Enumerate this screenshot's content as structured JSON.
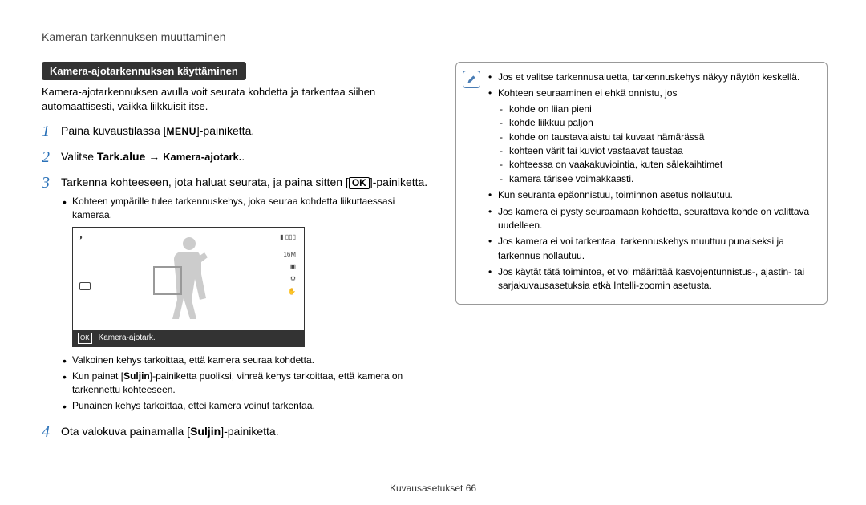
{
  "header": "Kameran tarkennuksen muuttaminen",
  "section_title": "Kamera-ajotarkennuksen käyttäminen",
  "intro": "Kamera-ajotarkennuksen avulla voit seurata kohdetta ja tarkentaa siihen automaattisesti, vaikka liikkuisit itse.",
  "steps": {
    "s1_a": "Paina kuvaustilassa [",
    "s1_menu": "MENU",
    "s1_b": "]-painiketta.",
    "s2_a": "Valitse ",
    "s2_b": "Tark.alue",
    "s2_c": " → ",
    "s2_d": "Kamera-ajotark.",
    "s2_e": ".",
    "s3_a": "Tarkenna kohteeseen, jota haluat seurata, ja paina sitten [",
    "s3_ok": "OK",
    "s3_b": "]-painiketta.",
    "s3_bullets": [
      "Kohteen ympärille tulee tarkennuskehys, joka seuraa kohdetta liikuttaessasi kameraa."
    ],
    "s3_caption_label": "Kamera-ajotark.",
    "s3_explain": {
      "a": "Valkoinen kehys tarkoittaa, että kamera seuraa kohdetta.",
      "b_pre": "Kun painat [",
      "b_bold": "Suljin",
      "b_post": "]-painiketta puoliksi, vihreä kehys tarkoittaa, että kamera on tarkennettu kohteeseen.",
      "c": "Punainen kehys tarkoittaa, ettei kamera voinut tarkentaa."
    },
    "s4_a": "Ota valokuva painamalla [",
    "s4_bold": "Suljin",
    "s4_b": "]-painiketta."
  },
  "info": {
    "l1": "Jos et valitse tarkennusaluetta, tarkennuskehys näkyy näytön keskellä.",
    "l2": "Kohteen seuraaminen ei ehkä onnistu, jos",
    "sub": [
      "kohde on liian pieni",
      "kohde liikkuu paljon",
      "kohde on taustavalaistu tai kuvaat hämärässä",
      "kohteen värit tai kuviot vastaavat taustaa",
      "kohteessa on vaakakuviointia, kuten sälekaihtimet",
      "kamera tärisee voimakkaasti."
    ],
    "l3": "Kun seuranta epäonnistuu, toiminnon asetus nollautuu.",
    "l4": "Jos kamera ei pysty seuraamaan kohdetta, seurattava kohde on valittava uudelleen.",
    "l5": "Jos kamera ei voi tarkentaa, tarkennuskehys muuttuu punaiseksi ja tarkennus nollautuu.",
    "l6": "Jos käytät tätä toimintoa, et voi määrittää kasvojentunnistus-, ajastin- tai sarjakuvausasetuksia etkä Intelli-zoomin asetusta."
  },
  "footer_a": "Kuvausasetukset  ",
  "footer_b": "66",
  "cam_overlay": {
    "tr": "▮ ▯▯▯",
    "r1": "16M",
    "r2": "▣",
    "r3": "⚙",
    "r4": "✋"
  }
}
